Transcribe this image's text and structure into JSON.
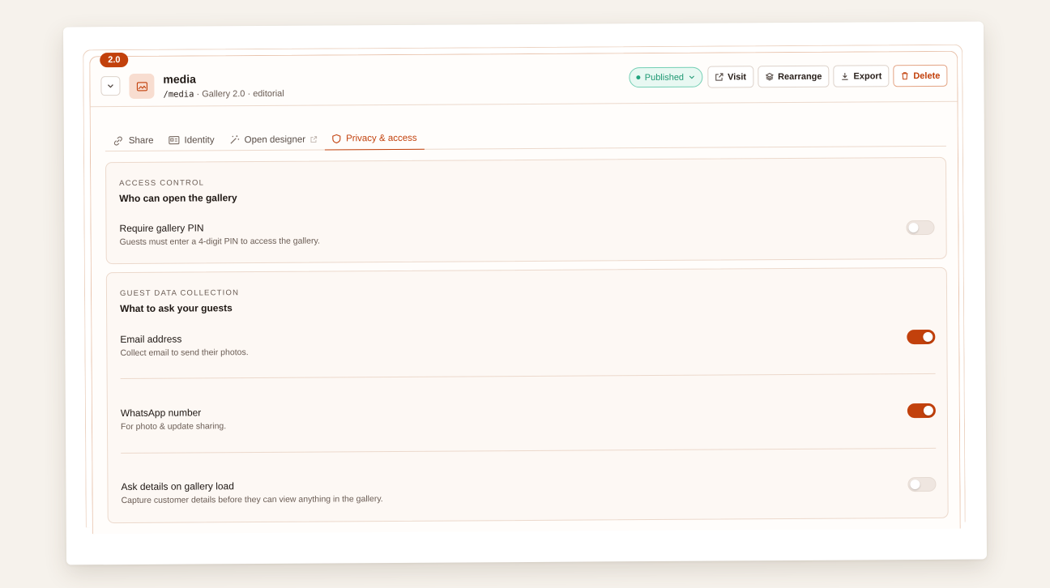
{
  "gallery": {
    "version_badge": "2.0",
    "name": "media",
    "path": "/media",
    "meta": "· Gallery 2.0 · editorial"
  },
  "header_actions": {
    "status": "Published",
    "visit": "Visit",
    "rearrange": "Rearrange",
    "export": "Export",
    "delete": "Delete"
  },
  "tabs": [
    {
      "label": "Share",
      "icon": "link-icon"
    },
    {
      "label": "Identity",
      "icon": "id-card-icon"
    },
    {
      "label": "Open designer",
      "icon": "magic-wand-icon"
    },
    {
      "label": "Privacy & access",
      "icon": "shield-icon",
      "active": true
    }
  ],
  "access_control": {
    "eyebrow": "ACCESS CONTROL",
    "title": "Who can open the gallery",
    "rows": [
      {
        "label": "Require gallery PIN",
        "desc": "Guests must enter a 4-digit PIN to access the gallery.",
        "enabled": false
      }
    ]
  },
  "guest_data": {
    "eyebrow": "GUEST DATA COLLECTION",
    "title": "What to ask your guests",
    "rows": [
      {
        "label": "Email address",
        "desc": "Collect email to send their photos.",
        "enabled": true
      },
      {
        "label": "WhatsApp number",
        "desc": "For photo & update sharing.",
        "enabled": true
      },
      {
        "label": "Ask details on gallery load",
        "desc": "Capture customer details before they can view anything in the gallery.",
        "enabled": false
      }
    ]
  },
  "colors": {
    "accent": "#c2410c",
    "published_green": "#1f9873",
    "background": "#f6f2ec"
  }
}
